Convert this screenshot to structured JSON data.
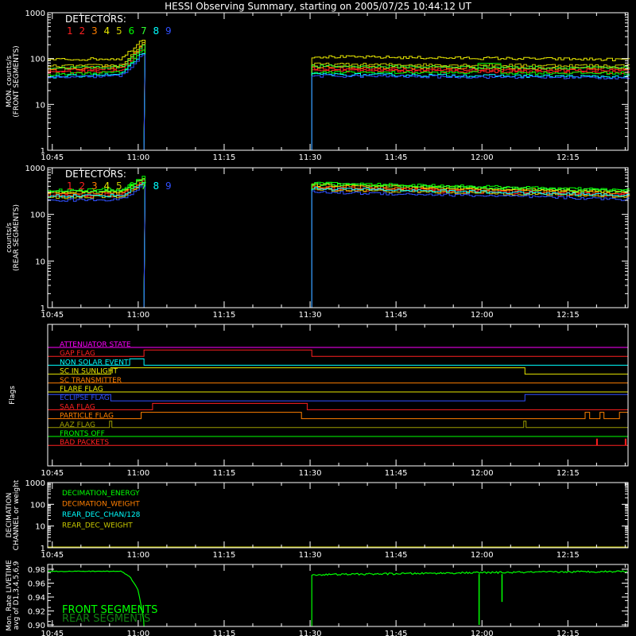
{
  "chart_data": {
    "title": "HESSI Observing Summary, starting on 2005/07/25 10:44:12 UT",
    "time_ticks": [
      "10:45",
      "11:00",
      "11:15",
      "11:30",
      "11:45",
      "12:00",
      "12:15"
    ],
    "time_tick_minutes": [
      45,
      60,
      75,
      90,
      105,
      120,
      135
    ],
    "xlim_minutes": [
      44.2,
      145.5
    ],
    "colors": {
      "d1": "#ff2020",
      "d2": "#ff2020",
      "d3": "#ff7f00",
      "d4": "#e8e800",
      "d5": "#c8c800",
      "d6": "#00ff00",
      "d7": "#30ff30",
      "d8": "#00ffff",
      "d9": "#3050ff",
      "axis": "#ffffff",
      "title": "#ffffff"
    },
    "panels": [
      {
        "id": "front",
        "type": "line",
        "ylabel": [
          "MON. counts/s",
          "(FRONT SEGMENTS)"
        ],
        "scale": "log",
        "ylim": [
          1,
          1000
        ],
        "ytick_labels": [
          "1",
          "10",
          "100",
          "1000"
        ],
        "legend_title": "DETECTORS:",
        "legend_entries": [
          "1",
          "2",
          "3",
          "4",
          "5",
          "6",
          "7",
          "8",
          "9"
        ],
        "gaps": [
          [
            61.0,
            90.3
          ]
        ],
        "series": [
          {
            "name": "1",
            "before": [
              55,
              62,
              210
            ],
            "after": [
              60,
              55
            ]
          },
          {
            "name": "2",
            "before": [
              50,
              55,
              180
            ],
            "after": [
              55,
              50
            ]
          },
          {
            "name": "3",
            "before": [
              60,
              65,
              230
            ],
            "after": [
              65,
              60
            ]
          },
          {
            "name": "4",
            "before": [
              95,
              100,
              290
            ],
            "after": [
              110,
              95
            ]
          },
          {
            "name": "5",
            "before": [
              68,
              72,
              240
            ],
            "after": [
              75,
              70
            ]
          },
          {
            "name": "6",
            "before": [
              45,
              50,
              170
            ],
            "after": [
              50,
              48
            ]
          },
          {
            "name": "7",
            "before": [
              62,
              66,
              210
            ],
            "after": [
              68,
              62
            ]
          },
          {
            "name": "8",
            "before": [
              40,
              45,
              150
            ],
            "after": [
              45,
              40
            ]
          },
          {
            "name": "9",
            "before": [
              38,
              42,
              130
            ],
            "after": [
              42,
              38
            ]
          }
        ]
      },
      {
        "id": "rear",
        "type": "line",
        "ylabel": [
          "counts/s",
          "(REAR SEGMENTS)"
        ],
        "scale": "log",
        "ylim": [
          1,
          1000
        ],
        "ytick_labels": [
          "1",
          "10",
          "100",
          "1000"
        ],
        "legend_title": "DETECTORS:",
        "legend_entries": [
          "1",
          "2",
          "3",
          "4",
          "5",
          "6",
          "7",
          "8",
          "9"
        ],
        "gaps": [
          [
            61.0,
            90.3
          ]
        ],
        "series": [
          {
            "name": "1",
            "before": [
              260,
              270,
              520
            ],
            "after": [
              380,
              270
            ]
          },
          {
            "name": "2",
            "before": [
              240,
              250,
              480
            ],
            "after": [
              350,
              250
            ]
          },
          {
            "name": "3",
            "before": [
              280,
              290,
              560
            ],
            "after": [
              400,
              290
            ]
          },
          {
            "name": "4",
            "before": [
              300,
              310,
              600
            ],
            "after": [
              430,
              300
            ]
          },
          {
            "name": "5",
            "before": [
              230,
              240,
              460
            ],
            "after": [
              340,
              240
            ]
          },
          {
            "name": "6",
            "before": [
              330,
              340,
              650
            ],
            "after": [
              470,
              330
            ]
          },
          {
            "name": "7",
            "before": [
              310,
              320,
              620
            ],
            "after": [
              450,
              310
            ]
          },
          {
            "name": "8",
            "before": [
              250,
              255,
              500
            ],
            "after": [
              360,
              255
            ]
          },
          {
            "name": "9",
            "before": [
              200,
              210,
              420
            ],
            "after": [
              300,
              210
            ]
          }
        ]
      },
      {
        "id": "flags",
        "type": "step",
        "ylabel": [
          "Flags"
        ],
        "flags": [
          {
            "label": "ATTENUATOR STATE",
            "color": "#ff00ff",
            "high_intervals": []
          },
          {
            "label": "GAP FLAG",
            "color": "#ff2020",
            "high_intervals": [
              [
                61.0,
                90.3
              ]
            ]
          },
          {
            "label": "NON SOLAR EVENT",
            "color": "#00ffff",
            "high_intervals": [
              [
                58.5,
                61.0
              ]
            ]
          },
          {
            "label": "SC IN SUNLIGHT",
            "color": "#e8e800",
            "high_intervals": [
              [
                55.2,
                127.5
              ]
            ]
          },
          {
            "label": "SC TRANSMITTER",
            "color": "#ff7f00",
            "high_intervals": []
          },
          {
            "label": "FLARE FLAG",
            "color": "#e8e800",
            "high_intervals": []
          },
          {
            "label": "ECLIPSE FLAG",
            "color": "#3050ff",
            "high_intervals": [
              [
                44.2,
                55.2
              ],
              [
                127.5,
                145.5
              ]
            ]
          },
          {
            "label": "SAA FLAG",
            "color": "#ff2020",
            "high_intervals": [
              [
                62.5,
                89.5
              ]
            ]
          },
          {
            "label": "PARTICLE FLAG",
            "color": "#ff7f00",
            "high_intervals": [
              [
                60.5,
                88.5
              ],
              [
                138.0,
                138.8
              ],
              [
                140.6,
                141.3
              ],
              [
                144.0,
                145.5
              ]
            ]
          },
          {
            "label": "AAZ FLAG",
            "color": "#a0a000",
            "high_intervals": [
              [
                55.0,
                55.4
              ],
              [
                127.3,
                127.7
              ]
            ]
          },
          {
            "label": "FRONTS OFF",
            "color": "#00ff00",
            "high_intervals": []
          },
          {
            "label": "BAD PACKETS",
            "color": "#ff2020",
            "high_intervals": [
              [
                140.0,
                140.15
              ],
              [
                145.0,
                145.15
              ]
            ]
          }
        ]
      },
      {
        "id": "decimation",
        "type": "line",
        "ylabel": [
          "DECIMATION",
          "CHANNEL or weight"
        ],
        "scale": "log",
        "ylim": [
          1,
          1000
        ],
        "ytick_labels": [
          "1",
          "10",
          "100",
          "1000"
        ],
        "legend_entries": [
          {
            "label": "DECIMATION_ENERGY",
            "color": "#00ff00"
          },
          {
            "label": "DECIMATION_WEIGHT",
            "color": "#ff7f00"
          },
          {
            "label": "REAR_DEC_CHAN/128",
            "color": "#00ffff"
          },
          {
            "label": "REAR_DEC_WEIGHT",
            "color": "#c8c800"
          }
        ]
      },
      {
        "id": "livetime",
        "type": "line",
        "ylabel": [
          "Mon. Rate LIVETIME",
          "avg of D1,3,4,5,6,9"
        ],
        "scale": "linear",
        "ylim": [
          0.9,
          0.98
        ],
        "ytick_labels": [
          "0.90",
          "0.92",
          "0.94",
          "0.96",
          "0.98"
        ],
        "legend_entries": [
          {
            "label": "FRONT SEGMENTS",
            "color": "#00ff00"
          },
          {
            "label": "REAR SEGMENTS",
            "color": "#108010"
          }
        ],
        "front_before": {
          "x": [
            44.2,
            57.0,
            58.5,
            60.0,
            61.0
          ],
          "y": [
            0.977,
            0.977,
            0.97,
            0.95,
            0.905
          ]
        },
        "front_after": {
          "x": [
            90.3,
            119.0,
            145.5
          ],
          "y": [
            0.972,
            0.975,
            0.977
          ]
        },
        "dips": [
          {
            "x": 119.5,
            "y": 0.9
          },
          {
            "x": 123.5,
            "y": 0.933
          }
        ]
      }
    ]
  }
}
